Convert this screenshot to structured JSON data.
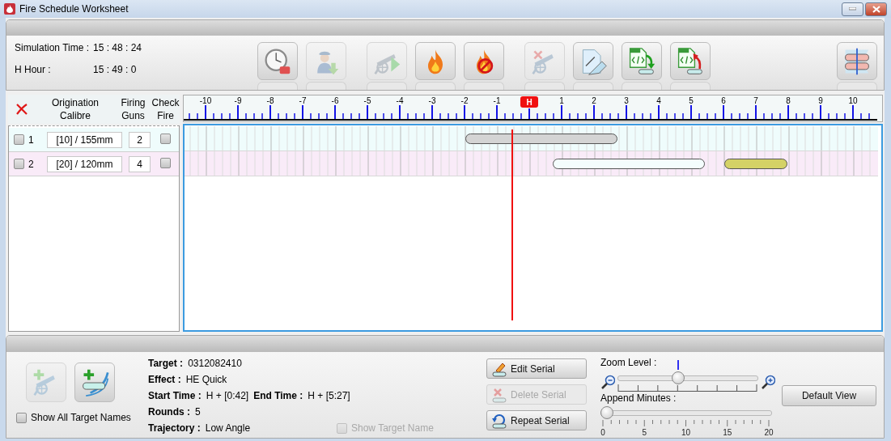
{
  "window": {
    "title": "Fire Schedule Worksheet"
  },
  "clock": [
    {
      "label": "Simulation Time :",
      "value": "15 : 48 : 24"
    },
    {
      "label": "H Hour :",
      "value": "15 : 49 : 0"
    }
  ],
  "toolbar": {
    "groups": [
      {
        "buttons": [
          {
            "kind": "h-hour",
            "disabled": false
          },
          {
            "kind": "observer",
            "disabled": true
          }
        ]
      },
      {
        "buttons": [
          {
            "kind": "cannon-play",
            "disabled": true
          },
          {
            "kind": "fire",
            "disabled": false
          },
          {
            "kind": "fire-no",
            "disabled": false
          }
        ]
      },
      {
        "buttons": [
          {
            "kind": "cannon-x",
            "disabled": true
          },
          {
            "kind": "eraser",
            "disabled": false
          },
          {
            "kind": "xml-import",
            "disabled": false
          },
          {
            "kind": "xml-export",
            "disabled": false
          }
        ]
      },
      {
        "buttons": [
          {
            "kind": "layout",
            "disabled": false
          }
        ]
      }
    ]
  },
  "columns": [
    "Origination Calibre",
    "Firing Guns",
    "Check Fire"
  ],
  "rows": [
    {
      "checked": false,
      "number": "1",
      "calibre": "[10] / 155mm",
      "guns": "2",
      "check_fire": false,
      "color": "#effcfc",
      "bars": [
        {
          "color": "#d4d4d4"
        }
      ]
    },
    {
      "checked": false,
      "number": "2",
      "calibre": "[20] / 120mm",
      "guns": "4",
      "check_fire": false,
      "color": "#f9ebf8",
      "bars": [
        {
          "color": "#f4fdfd"
        },
        {
          "color": "#d4d266"
        }
      ]
    }
  ],
  "ruler": {
    "ticks": [
      {
        "kind": "number",
        "label": "-10"
      },
      {
        "kind": "number",
        "label": "-9"
      },
      {
        "kind": "number",
        "label": "-8"
      },
      {
        "kind": "number",
        "label": "-7"
      },
      {
        "kind": "number",
        "label": "-6"
      },
      {
        "kind": "number",
        "label": "-5"
      },
      {
        "kind": "number",
        "label": "-4"
      },
      {
        "kind": "number",
        "label": "-3"
      },
      {
        "kind": "number",
        "label": "-2"
      },
      {
        "kind": "number",
        "label": "-1"
      },
      {
        "kind": "marker",
        "label": "H"
      },
      {
        "kind": "number",
        "label": "1"
      },
      {
        "kind": "number",
        "label": "2"
      },
      {
        "kind": "number",
        "label": "3"
      },
      {
        "kind": "number",
        "label": "4"
      },
      {
        "kind": "number",
        "label": "5"
      },
      {
        "kind": "number",
        "label": "6"
      },
      {
        "kind": "number",
        "label": "7"
      },
      {
        "kind": "number",
        "label": "8"
      },
      {
        "kind": "number",
        "label": "9"
      },
      {
        "kind": "number",
        "label": "10"
      }
    ]
  },
  "add_buttons": [
    {
      "kind": "add-gun",
      "disabled": true
    },
    {
      "kind": "add-serial",
      "disabled": false
    }
  ],
  "show_all_target_names": {
    "label": "Show All Target Names",
    "checked": false
  },
  "details": [
    {
      "items": [
        {
          "label": "Target :",
          "value": "0312082410"
        }
      ]
    },
    {
      "items": [
        {
          "label": "Effect :",
          "value": "HE Quick"
        }
      ]
    },
    {
      "items": [
        {
          "label": "Start Time :",
          "value": "H + [0:42]"
        },
        {
          "label": "End Time :",
          "value": "H + [5:27]"
        }
      ]
    },
    {
      "items": [
        {
          "label": "Rounds :",
          "value": "5"
        }
      ]
    },
    {
      "items": [
        {
          "label": "Trajectory :",
          "value": "Low Angle"
        }
      ]
    }
  ],
  "show_target_name": {
    "label": "Show Target Name",
    "checked": false,
    "disabled": true
  },
  "serial_buttons": [
    {
      "kind": "edit",
      "label": "Edit Serial",
      "disabled": false
    },
    {
      "kind": "delete",
      "label": "Delete Serial",
      "disabled": true
    },
    {
      "kind": "repeat",
      "label": "Repeat Serial",
      "disabled": false
    }
  ],
  "zoom": {
    "label": "Zoom Level :",
    "level": 0.43
  },
  "append": {
    "label": "Append Minutes :",
    "level": 0,
    "ticks": [
      "0",
      "5",
      "10",
      "15",
      "20"
    ]
  },
  "default_view": {
    "label": "Default View"
  }
}
